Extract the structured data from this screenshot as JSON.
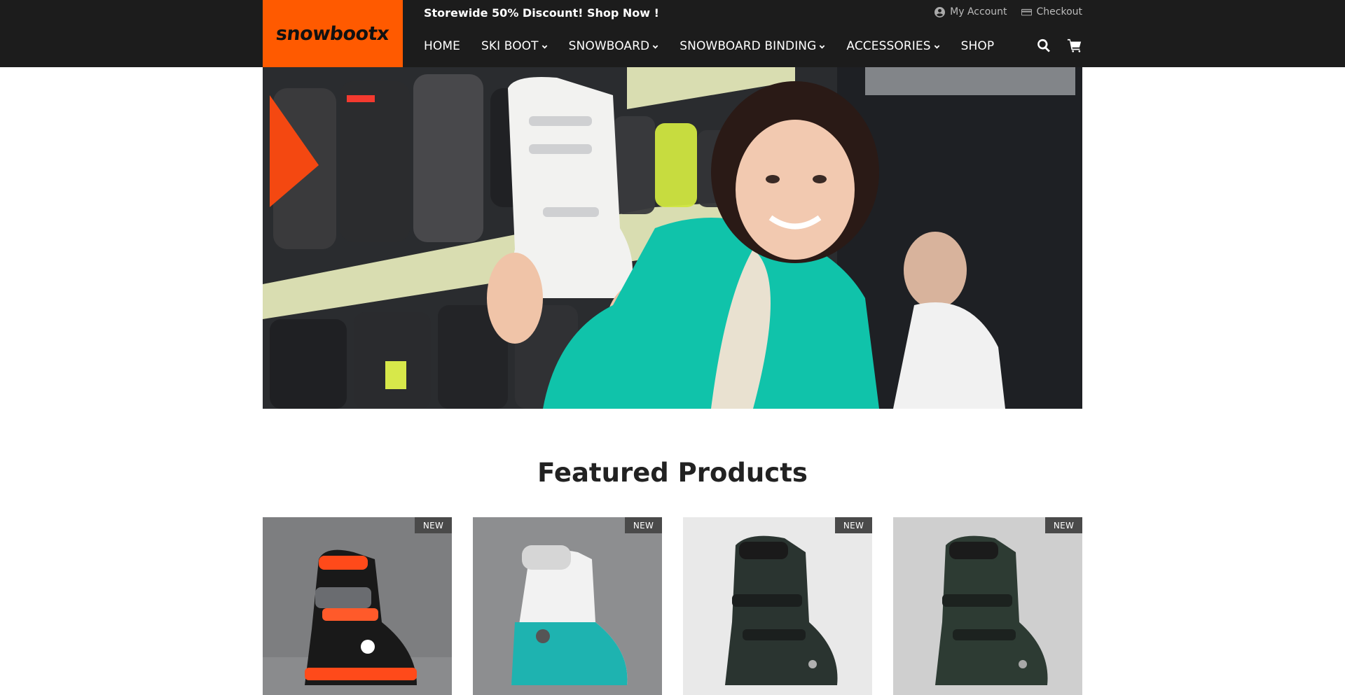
{
  "header": {
    "logo_text": "snowbootx",
    "promo": "Storewide 50% Discount! Shop Now !",
    "account_label": "My Account",
    "checkout_label": "Checkout"
  },
  "nav": {
    "items": [
      {
        "label": "HOME",
        "dropdown": false
      },
      {
        "label": "SKI BOOT",
        "dropdown": true
      },
      {
        "label": "SNOWBOARD",
        "dropdown": true
      },
      {
        "label": "SNOWBOARD BINDING",
        "dropdown": true
      },
      {
        "label": "ACCESSORIES",
        "dropdown": true
      },
      {
        "label": "SHOP",
        "dropdown": false
      }
    ],
    "icons": [
      "search-icon",
      "cart-icon"
    ]
  },
  "hero": {
    "image": "photo-woman-holding-ski-boot"
  },
  "featured": {
    "title": "Featured Products",
    "products": [
      {
        "badge": "NEW",
        "image": "ski-boot-black-orange"
      },
      {
        "badge": "NEW",
        "image": "ski-boot-white-teal"
      },
      {
        "badge": "NEW",
        "image": "ski-boot-dark-green"
      },
      {
        "badge": "NEW",
        "image": "ski-boot-dark-green-2"
      }
    ]
  },
  "colors": {
    "header_bg": "#1c1c1c",
    "logo_bg": "#ff5a00",
    "badge_bg": "#4a4a4a",
    "text": "#222222"
  }
}
